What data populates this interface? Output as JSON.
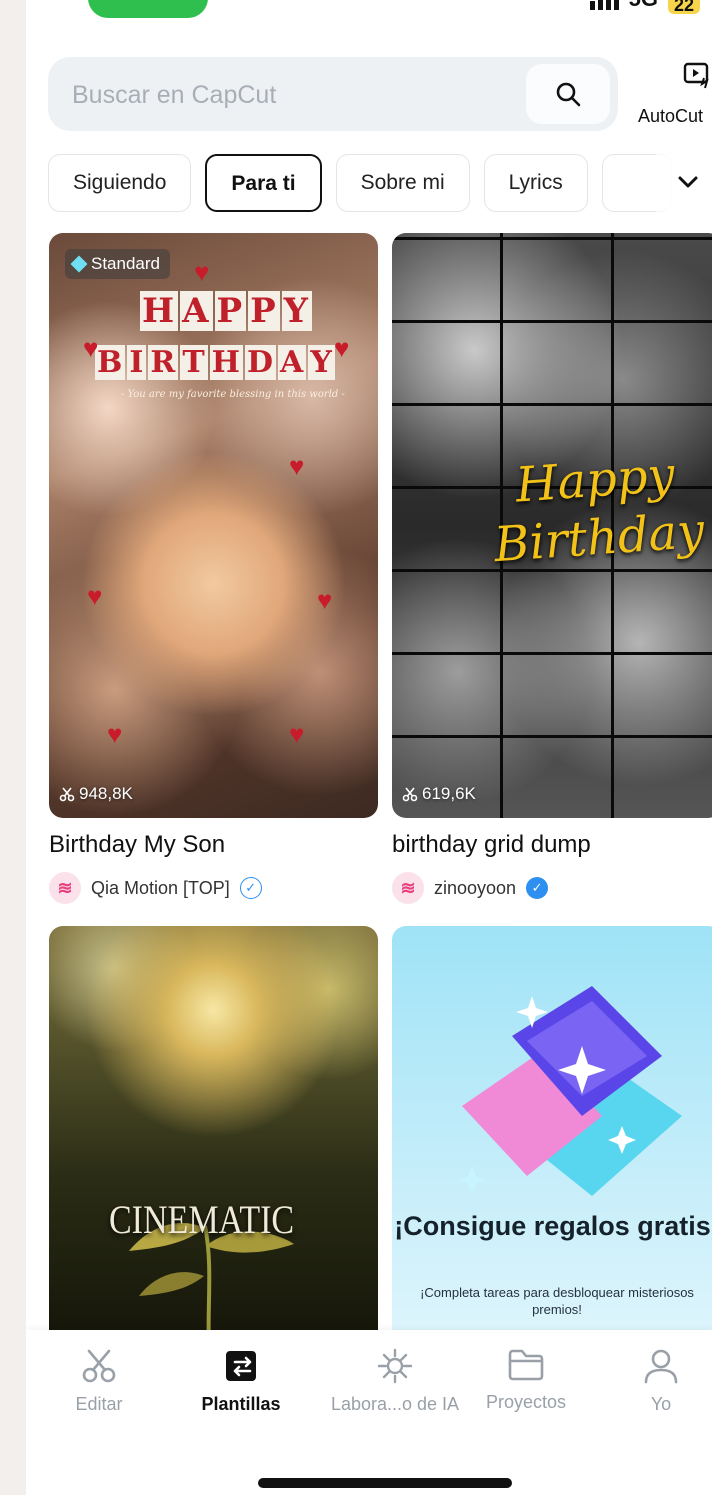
{
  "status_bar": {
    "network": "5G",
    "battery": "22"
  },
  "search": {
    "placeholder": "Buscar en CapCut"
  },
  "autocut": {
    "label": "AutoCut"
  },
  "tabs": [
    {
      "label": "Siguiendo"
    },
    {
      "label": "Para ti"
    },
    {
      "label": "Sobre mi"
    },
    {
      "label": "Lyrics"
    }
  ],
  "cards": [
    {
      "title": "Birthday My Son",
      "author": "Qia Motion [TOP]",
      "badge": "Standard",
      "usage": "948,8K",
      "overlay_line1": [
        "H",
        "A",
        "P",
        "P",
        "Y"
      ],
      "overlay_line2": [
        "B",
        "I",
        "R",
        "T",
        "H",
        "D",
        "A",
        "Y"
      ],
      "overlay_sub": "- You are my favorite blessing in this world -"
    },
    {
      "title": "birthday grid dump",
      "author": "zinooyoon",
      "usage": "619,6K",
      "overlay_line1": "Happy",
      "overlay_line2": "Birthday"
    },
    {
      "overlay": "CINEMATIC"
    },
    {
      "promo_title": "¡Consigue regalos gratis!",
      "promo_sub": "¡Completa tareas para desbloquear misteriosos premios!"
    }
  ],
  "bottom_nav": [
    {
      "label": "Editar",
      "icon": "scissors-icon"
    },
    {
      "label": "Plantillas",
      "icon": "templates-icon"
    },
    {
      "label": "Labora...o de IA",
      "icon": "ai-lab-icon"
    },
    {
      "label": "Proyectos",
      "icon": "folder-icon"
    },
    {
      "label": "Yo",
      "icon": "profile-icon"
    }
  ],
  "colors": {
    "accent_green": "#2fbf4f",
    "verified_blue": "#2f8ff0",
    "heart_red": "#c81c2a",
    "birthday_gold": "#f2c218"
  }
}
